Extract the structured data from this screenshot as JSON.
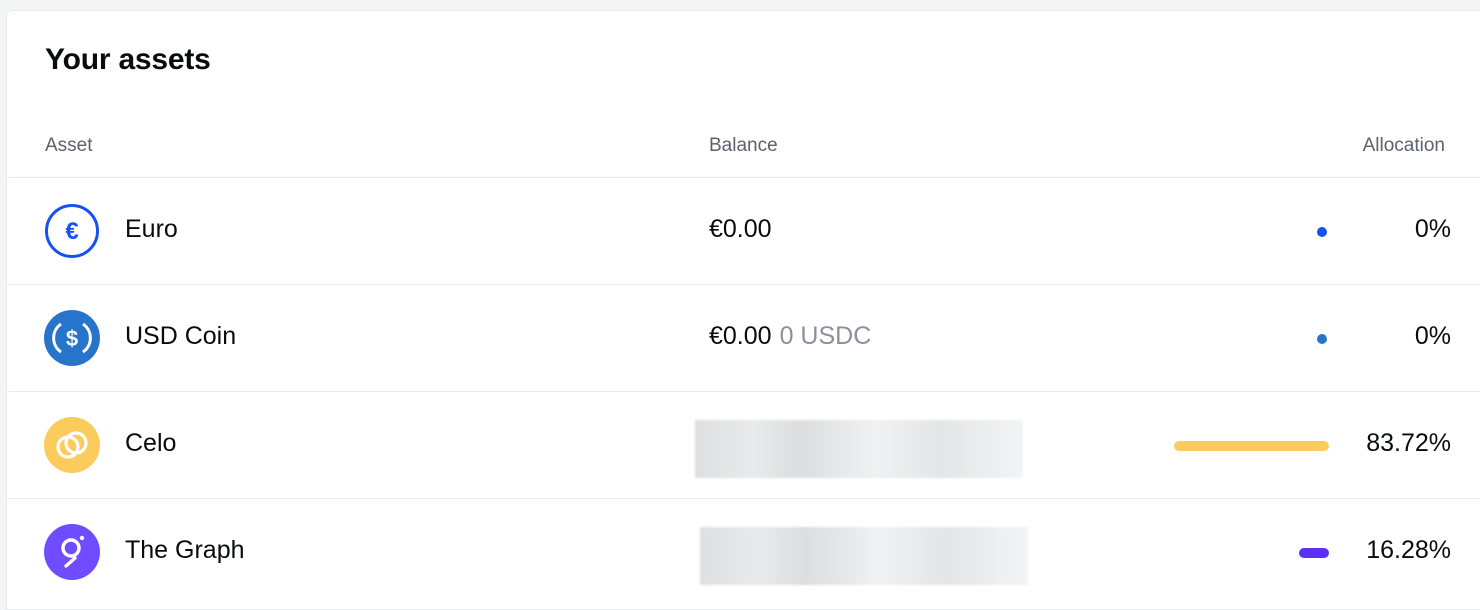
{
  "panel": {
    "title": "Your assets",
    "columns": {
      "asset": "Asset",
      "balance": "Balance",
      "allocation": "Allocation"
    }
  },
  "assets": [
    {
      "name": "Euro",
      "icon": "euro-icon",
      "balance": "€0.00",
      "balance_sub": "",
      "allocation": "0%",
      "allocation_value": 0,
      "color": "#1652f0",
      "balance_hidden": false
    },
    {
      "name": "USD Coin",
      "icon": "usdc-icon",
      "balance": "€0.00",
      "balance_sub": "0 USDC",
      "allocation": "0%",
      "allocation_value": 0,
      "color": "#2775ca",
      "balance_hidden": false
    },
    {
      "name": "Celo",
      "icon": "celo-icon",
      "balance": "",
      "balance_sub": "",
      "allocation": "83.72%",
      "allocation_value": 83.72,
      "color": "#fbcc5c",
      "balance_hidden": true
    },
    {
      "name": "The Graph",
      "icon": "the-graph-icon",
      "balance": "",
      "balance_sub": "",
      "allocation": "16.28%",
      "allocation_value": 16.28,
      "color": "#6f4cff",
      "balance_hidden": true
    }
  ]
}
